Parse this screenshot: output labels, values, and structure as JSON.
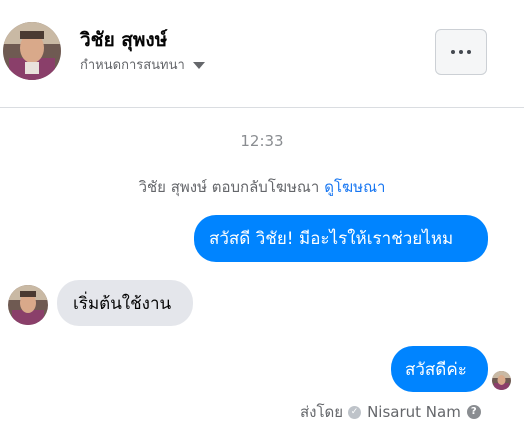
{
  "header": {
    "contact_name": "วิชัย สุพงษ์",
    "subtitle": "กำหนดการสนทนา",
    "more_icon": "ellipsis-horizontal-icon"
  },
  "conversation": {
    "timestamp": "12:33",
    "notice": {
      "text": "วิชัย สุพงษ์ ตอบกลับโฆษณา",
      "link": "ดูโฆษณา"
    },
    "messages": [
      {
        "direction": "outgoing",
        "text": "สวัสดี วิชัย! มีอะไรให้เราช่วยไหม"
      },
      {
        "direction": "incoming",
        "text": "เริ่มต้นใช้งาน"
      },
      {
        "direction": "outgoing",
        "text": "สวัสดีค่ะ"
      }
    ],
    "sent_by": {
      "label": "ส่งโดย",
      "sender": "Nisarut Nam",
      "help_icon": "question-circle-icon"
    }
  },
  "colors": {
    "outgoing_bubble": "#0084ff",
    "incoming_bubble": "#e4e6eb",
    "link": "#1877f2",
    "secondary_text": "#65676b"
  }
}
